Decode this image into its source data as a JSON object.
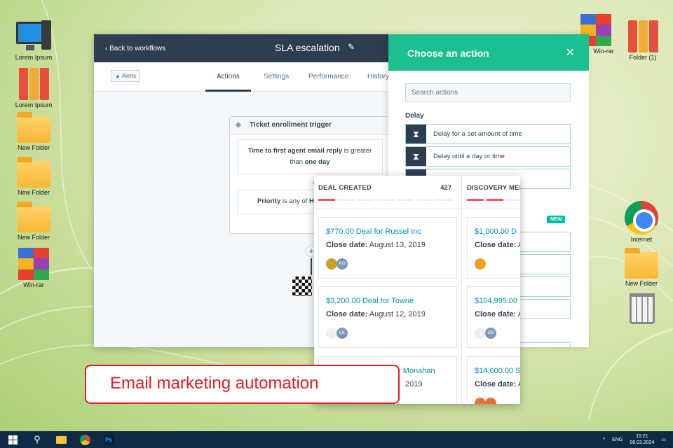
{
  "desktop": {
    "icons_left": [
      "Lorem Ipsum",
      "Lorem Ipsum",
      "New Folder",
      "New Folder",
      "New Folder",
      "Win-rar"
    ],
    "icons_right": [
      "Win-rar",
      "Folder (1)",
      "Internet",
      "New Folder"
    ]
  },
  "workflow": {
    "back_label": "Back to workflows",
    "title": "SLA escalation",
    "alerts_label": "Alerts",
    "tabs": [
      "Actions",
      "Settings",
      "Performance",
      "History"
    ],
    "active_tab": "Actions",
    "trigger": {
      "title": "Ticket enrollment trigger",
      "condition1_a": "Time to first agent email reply",
      "condition1_b": "is greater than",
      "condition1_c": "one day",
      "and_label": "and",
      "condition2_a": "Priority",
      "condition2_b": "is any of",
      "condition2_c": "H"
    },
    "add_label": "+"
  },
  "action_panel": {
    "title": "Choose an action",
    "close": "✕",
    "search_placeholder": "Search actions",
    "section_label": "Delay",
    "actions": [
      "Delay for a set amount of time",
      "Delay until a day or time"
    ],
    "new_badge": "NEW"
  },
  "deals": {
    "columns": [
      {
        "name": "DEAL CREATED",
        "count": "427",
        "cards": [
          {
            "amount": "$770.00 Deal for Russel Inc",
            "close_label": "Close date:",
            "close_date": "August 13, 2019",
            "avatar": "KG"
          },
          {
            "amount": "$3,200.00 Deal for Towne",
            "close_label": "Close date:",
            "close_date": "August 12, 2019",
            "avatar": "LK"
          },
          {
            "amount": "r Monahan",
            "close_label": "",
            "close_date": "2019",
            "avatar": ""
          }
        ]
      },
      {
        "name": "DISCOVERY MEE",
        "count": "",
        "cards": [
          {
            "amount": "$1,000.00 D",
            "close_label": "Close date:",
            "close_date": "A",
            "avatar": ""
          },
          {
            "amount": "$104,995.00",
            "close_label": "Close date:",
            "close_date": "A",
            "avatar": "DB"
          },
          {
            "amount": "$14,600.00 S",
            "close_label": "Close date:",
            "close_date": "A",
            "avatar": ""
          }
        ]
      }
    ]
  },
  "caption": "Email marketing automation",
  "taskbar": {
    "lang": "ENG",
    "time": "15:21",
    "date": "08.02.2024",
    "ps_label": "Ps"
  },
  "colors": {
    "accent": "#1cbf8f",
    "header": "#2d3e50",
    "caption_red": "#e31c23",
    "link": "#0091ae"
  }
}
